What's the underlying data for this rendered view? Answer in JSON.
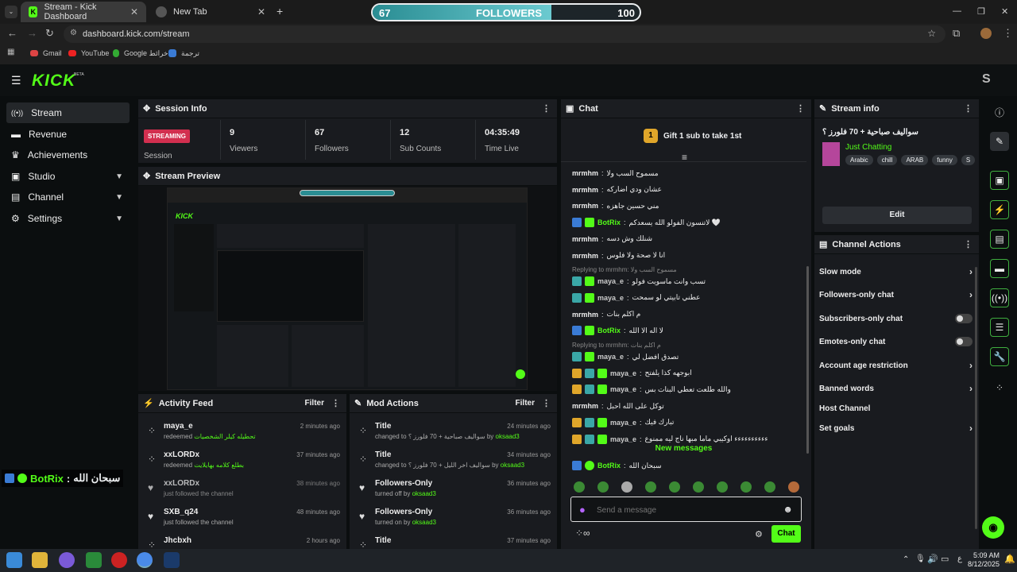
{
  "browser": {
    "tabs": [
      {
        "label": "Stream - Kick Dashboard"
      },
      {
        "label": "New Tab"
      }
    ],
    "url": "dashboard.kick.com/stream",
    "bookmarks": [
      "Gmail",
      "YouTube",
      "Google خرائط",
      "ترجمة"
    ]
  },
  "goal_bar": {
    "current": "67",
    "label": "FOLLOWERS",
    "target": "100",
    "fill_fraction": 0.67
  },
  "app": {
    "logo": "KICK",
    "beta": "BETA",
    "avatar_letter": "S"
  },
  "sidebar": {
    "items": [
      {
        "label": "Stream",
        "icon": "signal-icon"
      },
      {
        "label": "Revenue",
        "icon": "revenue-icon"
      },
      {
        "label": "Achievements",
        "icon": "trophy-icon"
      },
      {
        "label": "Studio",
        "icon": "studio-icon"
      },
      {
        "label": "Channel",
        "icon": "channel-icon"
      },
      {
        "label": "Settings",
        "icon": "gear-icon"
      }
    ]
  },
  "session": {
    "title": "Session Info",
    "status": "STREAMING",
    "status_label": "Session",
    "stats": [
      {
        "value": "9",
        "label": "Viewers"
      },
      {
        "value": "67",
        "label": "Followers"
      },
      {
        "value": "12",
        "label": "Sub Counts"
      },
      {
        "value": "04:35:49",
        "label": "Time Live"
      }
    ]
  },
  "preview": {
    "title": "Stream Preview"
  },
  "overlay": {
    "user": "BotRix",
    "sep": ":",
    "text": "سبحان الله"
  },
  "activity": {
    "title": "Activity Feed",
    "filter": "Filter",
    "rows": [
      {
        "user": "maya_e",
        "action": "redeemed",
        "detail": "تحطيله كيلر الشخصيات",
        "time": "2 minutes ago"
      },
      {
        "user": "xxLORDx",
        "action": "redeemed",
        "detail": "بطلع كلامه بهايلايت",
        "time": "37 minutes ago"
      },
      {
        "user": "xxLORDx",
        "action": "just followed the channel",
        "detail": "",
        "time": "38 minutes ago"
      },
      {
        "user": "SXB_q24",
        "action": "just followed the channel",
        "detail": "",
        "time": "48 minutes ago"
      },
      {
        "user": "Jhcbxh",
        "action": "",
        "detail": "",
        "time": "2 hours ago"
      }
    ]
  },
  "mod": {
    "title": "Mod Actions",
    "filter": "Filter",
    "rows": [
      {
        "title": "Title",
        "line": "changed to سواليف صباحية + 70 فلورز ؟",
        "by": "by",
        "who": "oksaad3",
        "time": "24 minutes ago"
      },
      {
        "title": "Title",
        "line": "changed to سواليف اخر الليل + 70 فلورز ؟",
        "by": "by",
        "who": "oksaad3",
        "time": "34 minutes ago"
      },
      {
        "title": "Followers-Only",
        "line": "turned off",
        "by": "by",
        "who": "oksaad3",
        "time": "36 minutes ago"
      },
      {
        "title": "Followers-Only",
        "line": "turned on",
        "by": "by",
        "who": "oksaad3",
        "time": "36 minutes ago"
      },
      {
        "title": "Title",
        "line": "",
        "by": "",
        "who": "",
        "time": "37 minutes ago"
      }
    ]
  },
  "chat": {
    "title": "Chat",
    "gift": {
      "count": "1",
      "text": "Gift 1 sub to take 1st"
    },
    "lines": [
      {
        "user": "mrmhm",
        "color": "#eeeeee",
        "text": "مسموح السب ولا",
        "badges": []
      },
      {
        "user": "mrmhm",
        "color": "#eeeeee",
        "text": "عشان ودي اضاركه",
        "badges": []
      },
      {
        "user": "mrmhm",
        "color": "#eeeeee",
        "text": "مني حسين جاهزه",
        "badges": []
      },
      {
        "user": "BotRix",
        "color": "#53fc18",
        "text": "لاتنسون الفولو الله يسعدكم 🤍",
        "badges": [
          "#3a7bd5",
          "#53fc18"
        ]
      },
      {
        "user": "mrmhm",
        "color": "#eeeeee",
        "text": "شنلك وش دسه",
        "badges": []
      },
      {
        "user": "mrmhm",
        "color": "#eeeeee",
        "text": "انا لا صحة ولا فلوس",
        "badges": []
      },
      {
        "reply": "Replying to mrmhm: مسموح السب ولا"
      },
      {
        "user": "maya_e",
        "color": "#cccccc",
        "text": "تسب وانت ماسويت فولو",
        "badges": [
          "#3aa7a7",
          "#53fc18"
        ]
      },
      {
        "user": "maya_e",
        "color": "#cccccc",
        "text": "عطني تابيتي لو سمحت",
        "badges": [
          "#3aa7a7",
          "#53fc18"
        ]
      },
      {
        "user": "mrmhm",
        "color": "#eeeeee",
        "text": "م اكلم بنات",
        "badges": []
      },
      {
        "user": "BotRix",
        "color": "#53fc18",
        "text": "لا اله الا الله",
        "badges": [
          "#3a7bd5",
          "#53fc18"
        ]
      },
      {
        "reply": "Replying to mrmhm: م اكلم بنات"
      },
      {
        "user": "maya_e",
        "color": "#cccccc",
        "text": "تصدق افضل لي",
        "badges": [
          "#3aa7a7",
          "#53fc18"
        ]
      },
      {
        "user": "maya_e",
        "color": "#cccccc",
        "text": "ابوجهه كذا يلفتح",
        "badges": [
          "#e0a62a",
          "#3aa7a7",
          "#53fc18"
        ]
      },
      {
        "user": "maya_e",
        "color": "#cccccc",
        "text": "والله طلعت تعطي البنات بس",
        "badges": [
          "#e0a62a",
          "#3aa7a7",
          "#53fc18"
        ]
      },
      {
        "user": "mrmhm",
        "color": "#eeeeee",
        "text": "توكل على الله احبل",
        "badges": []
      },
      {
        "user": "maya_e",
        "color": "#cccccc",
        "text": "تبارك فيك",
        "badges": [
          "#e0a62a",
          "#3aa7a7",
          "#53fc18"
        ]
      },
      {
        "user": "maya_e",
        "color": "#cccccc",
        "text": "ءءءءءءءءءء اوكيبي ماما مبها ناج ليه ممنوع",
        "badges": [
          "#e0a62a",
          "#3aa7a7",
          "#53fc18"
        ]
      }
    ],
    "new_messages": "New messages",
    "last": {
      "user": "BotRix",
      "text": "سبحان الله"
    },
    "placeholder": "Send a message",
    "send": "Chat"
  },
  "stream_info": {
    "title": "Stream info",
    "stream_title": "سواليف صباحية + 70 فلورز ؟",
    "category": "Just Chatting",
    "tags": [
      "Arabic",
      "chill",
      "ARAB",
      "funny",
      "S"
    ],
    "edit": "Edit"
  },
  "channel_actions": {
    "title": "Channel Actions",
    "items": [
      {
        "label": "Slow mode",
        "kind": "chevron"
      },
      {
        "label": "Followers-only chat",
        "kind": "chevron"
      },
      {
        "label": "Subscribers-only chat",
        "kind": "toggle"
      },
      {
        "label": "Emotes-only chat",
        "kind": "toggle"
      },
      {
        "label": "Account age restriction",
        "kind": "chevron"
      },
      {
        "label": "Banned words",
        "kind": "chevron"
      },
      {
        "label": "Host Channel",
        "kind": "none"
      },
      {
        "label": "Set goals",
        "kind": "chevron"
      }
    ]
  },
  "taskbar": {
    "time": "5:09 AM",
    "date": "8/12/2025",
    "lang": "ع"
  }
}
